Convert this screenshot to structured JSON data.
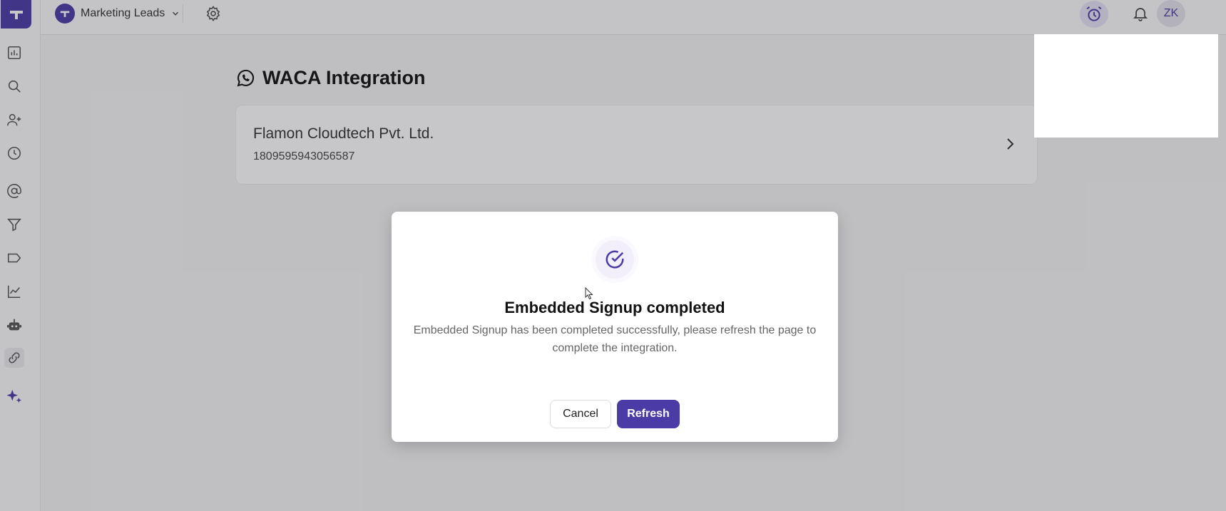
{
  "header": {
    "workspace_name": "Marketing Leads",
    "user_initials": "ZK"
  },
  "sidebar": {
    "items": [
      {
        "icon": "dashboard-icon"
      },
      {
        "icon": "search-icon"
      },
      {
        "icon": "add-user-icon"
      },
      {
        "icon": "history-icon"
      },
      {
        "icon": "mention-icon"
      },
      {
        "icon": "filter-icon"
      },
      {
        "icon": "tag-icon"
      },
      {
        "icon": "analytics-icon"
      },
      {
        "icon": "bot-icon"
      },
      {
        "icon": "integrations-icon",
        "active": true
      },
      {
        "icon": "ai-sparkle-icon"
      }
    ]
  },
  "main": {
    "title": "WACA Integration",
    "card": {
      "title": "Flamon Cloudtech Pvt. Ltd.",
      "subtitle": "1809595943056587"
    }
  },
  "modal": {
    "title": "Embedded Signup completed",
    "message": "Embedded Signup has been completed successfully, please refresh the page to complete the integration.",
    "cancel_label": "Cancel",
    "refresh_label": "Refresh"
  },
  "colors": {
    "brand": "#4b3ba6",
    "overlay": "rgba(40,40,45,0.26)"
  }
}
